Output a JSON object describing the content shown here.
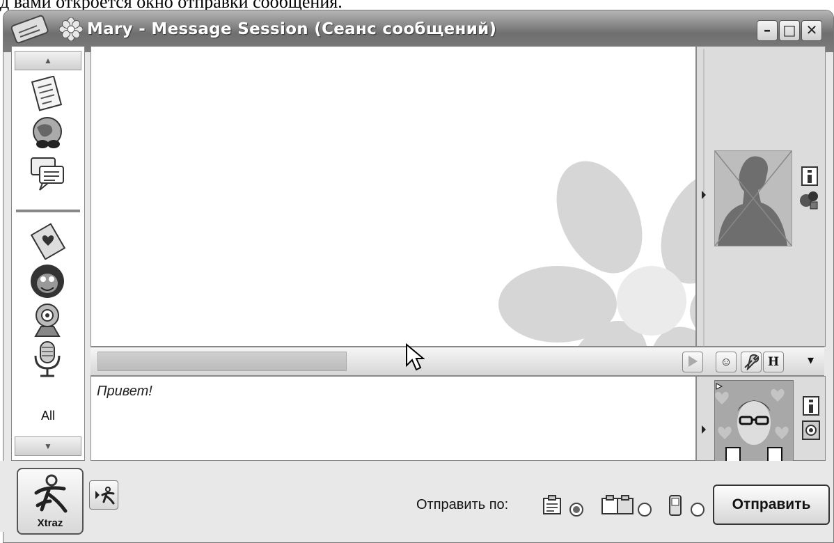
{
  "caption": "д вами откроется окно отправки сообщения.",
  "window": {
    "title": "Mary - Message Session (Сеанс сообщений)",
    "minimize": "–",
    "maximize": "□",
    "close": "✕"
  },
  "sidebar": {
    "up_arrow": "▲",
    "down_arrow": "▼",
    "all_label": "All",
    "icons": [
      "notepad-icon",
      "globe-icon",
      "chat-icon",
      "greeting-card-icon",
      "monkey-icon",
      "webcam-icon",
      "microphone-icon"
    ]
  },
  "toolbar": {
    "smiley": "☺",
    "font": "H",
    "dropdown": "▾"
  },
  "input": {
    "text": "Привет!"
  },
  "bottom": {
    "xtraz_label": "Xtraz",
    "send_via_label": "Отправить по:",
    "send_button": "Отправить"
  },
  "colors": {
    "titlebar": "#8a8a8a",
    "panel": "#dcdcdc"
  }
}
